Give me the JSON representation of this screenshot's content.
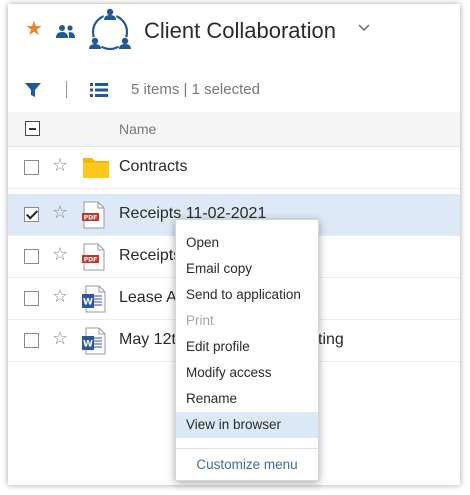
{
  "header": {
    "title": "Client Collaboration",
    "favorite_icon": "star-filled-icon",
    "members_icon": "people-icon",
    "workspace_icon": "collaboration-network-icon",
    "dropdown_icon": "chevron-down-icon"
  },
  "toolbar": {
    "filter_icon": "filter-icon",
    "view_icon": "list-view-icon",
    "count_text": "5 items | 1 selected"
  },
  "list": {
    "column_name": "Name",
    "rows": [
      {
        "name": "Contracts",
        "type": "folder",
        "selected": false
      },
      {
        "name": "Receipts 11-02-2021",
        "type": "pdf",
        "selected": true
      },
      {
        "name": "Receipts",
        "type": "pdf",
        "selected": false
      },
      {
        "name": "Lease A",
        "type": "word",
        "selected": false
      },
      {
        "name": "May 12t",
        "name_tail": "ting",
        "type": "word",
        "selected": false
      }
    ]
  },
  "context_menu": {
    "items": [
      {
        "label": "Open",
        "enabled": true
      },
      {
        "label": "Email copy",
        "enabled": true
      },
      {
        "label": "Send to application",
        "enabled": true
      },
      {
        "label": "Print",
        "enabled": false
      },
      {
        "label": "Edit profile",
        "enabled": true
      },
      {
        "label": "Modify access",
        "enabled": true
      },
      {
        "label": "Rename",
        "enabled": true
      },
      {
        "label": "View in browser",
        "enabled": true,
        "hovered": true
      }
    ],
    "customize_label": "Customize menu"
  },
  "colors": {
    "accent": "#1f5a96",
    "favorite": "#e8862b",
    "selected_row": "#dde9f6",
    "folder": "#f5b800",
    "pdf": "#c0392b",
    "word": "#2b5797"
  }
}
